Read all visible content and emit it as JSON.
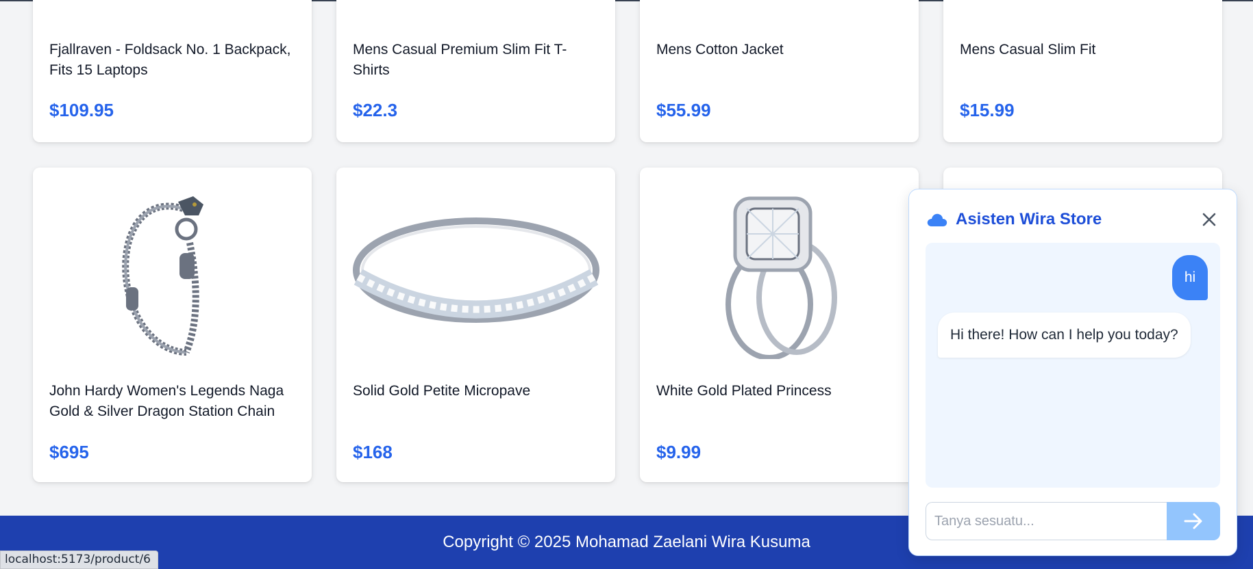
{
  "products_row1": [
    {
      "title": "Fjallraven - Foldsack No. 1 Backpack, Fits 15 Laptops",
      "price": "$109.95",
      "image": "backpack-image"
    },
    {
      "title": "Mens Casual Premium Slim Fit T-Shirts",
      "price": "$22.3",
      "image": "tshirt-image"
    },
    {
      "title": "Mens Cotton Jacket",
      "price": "$55.99",
      "image": "jacket-image"
    },
    {
      "title": "Mens Casual Slim Fit",
      "price": "$15.99",
      "image": "shirt-image"
    }
  ],
  "products_row2": [
    {
      "title": "John Hardy Women's Legends Naga Gold & Silver Dragon Station Chain Bracelet",
      "price": "$695",
      "image": "bracelet-image"
    },
    {
      "title": "Solid Gold Petite Micropave",
      "price": "$168",
      "image": "gold-ring-image"
    },
    {
      "title": "White Gold Plated Princess",
      "price": "$9.99",
      "image": "princess-ring-image"
    },
    {
      "title": "",
      "price": "",
      "image": ""
    }
  ],
  "chat": {
    "title": "Asisten Wira Store",
    "messages": [
      {
        "role": "user",
        "text": "hi"
      },
      {
        "role": "bot",
        "text": "Hi there! How can I help you today?"
      }
    ],
    "input_placeholder": "Tanya sesuatu...",
    "accent": "#3b82f6"
  },
  "footer": {
    "copyright": "Copyright © 2025 Mohamad Zaelani Wira Kusuma"
  },
  "status_bar": {
    "url": "localhost:5173/product/6"
  },
  "colors": {
    "footer_bg": "#1e40af",
    "price": "#2563eb"
  }
}
